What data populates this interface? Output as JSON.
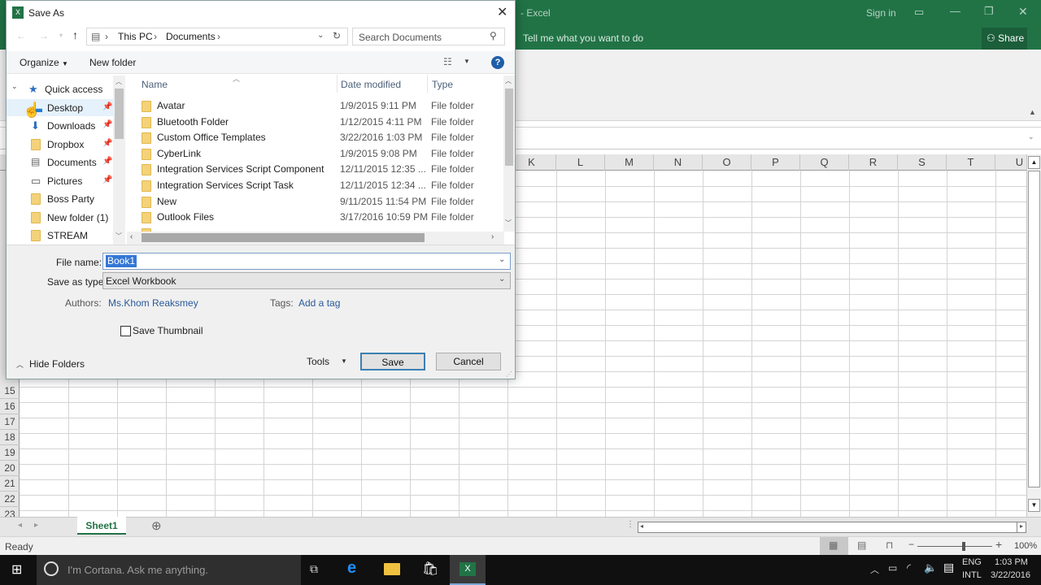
{
  "excel": {
    "title": "- Excel",
    "sign_in": "Sign in",
    "tell_me": "Tell me what you want to do",
    "share": "Share",
    "columns": [
      "K",
      "L",
      "M",
      "N",
      "O",
      "P",
      "Q",
      "R",
      "S",
      "T",
      "U"
    ],
    "rows": [
      "15",
      "16",
      "17",
      "18",
      "19",
      "20",
      "21",
      "22",
      "23"
    ],
    "sheet_tab": "Sheet1",
    "status": "Ready",
    "zoom": "100%",
    "zoom_level_percent": 100,
    "accent": "#217346"
  },
  "dialog": {
    "title": "Save As",
    "breadcrumb": [
      "This PC",
      "Documents"
    ],
    "search_placeholder": "Search Documents",
    "organize": "Organize",
    "new_folder": "New folder",
    "nav": [
      {
        "label": "Quick access",
        "icon": "star-icon",
        "pinned": false
      },
      {
        "label": "Desktop",
        "icon": "desktop-icon",
        "pinned": true
      },
      {
        "label": "Downloads",
        "icon": "download-icon",
        "pinned": true
      },
      {
        "label": "Dropbox",
        "icon": "folder-icon",
        "pinned": true
      },
      {
        "label": "Documents",
        "icon": "documents-icon",
        "pinned": true
      },
      {
        "label": "Pictures",
        "icon": "pictures-icon",
        "pinned": true
      },
      {
        "label": "Boss Party",
        "icon": "folder-icon",
        "pinned": false
      },
      {
        "label": "New folder (1)",
        "icon": "folder-icon",
        "pinned": false
      },
      {
        "label": "STREAM",
        "icon": "folder-icon",
        "pinned": false
      }
    ],
    "columns": {
      "name": "Name",
      "date": "Date modified",
      "type": "Type"
    },
    "files": [
      {
        "name": "Avatar",
        "date": "1/9/2015 9:11 PM",
        "type": "File folder"
      },
      {
        "name": "Bluetooth Folder",
        "date": "1/12/2015 4:11 PM",
        "type": "File folder"
      },
      {
        "name": "Custom Office Templates",
        "date": "3/22/2016 1:03 PM",
        "type": "File folder"
      },
      {
        "name": "CyberLink",
        "date": "1/9/2015 9:08 PM",
        "type": "File folder"
      },
      {
        "name": "Integration Services Script Component",
        "date": "12/11/2015 12:35 ...",
        "type": "File folder"
      },
      {
        "name": "Integration Services Script Task",
        "date": "12/11/2015 12:34 ...",
        "type": "File folder"
      },
      {
        "name": "New",
        "date": "9/11/2015 11:54 PM",
        "type": "File folder"
      },
      {
        "name": "Outlook Files",
        "date": "3/17/2016 10:59 PM",
        "type": "File folder"
      }
    ],
    "file_name_label": "File name:",
    "file_name_value": "Book1",
    "save_type_label": "Save as type:",
    "save_type_value": "Excel Workbook",
    "authors_label": "Authors:",
    "authors_value": "Ms.Khom Reaksmey",
    "tags_label": "Tags:",
    "tags_value": "Add a tag",
    "thumbnail_label": "Save Thumbnail",
    "thumbnail_checked": false,
    "hide_folders": "Hide Folders",
    "tools": "Tools",
    "save": "Save",
    "cancel": "Cancel"
  },
  "taskbar": {
    "cortana_placeholder": "I'm Cortana. Ask me anything.",
    "lang_top": "ENG",
    "lang_bottom": "INTL",
    "time": "1:03 PM",
    "date": "3/22/2016"
  }
}
